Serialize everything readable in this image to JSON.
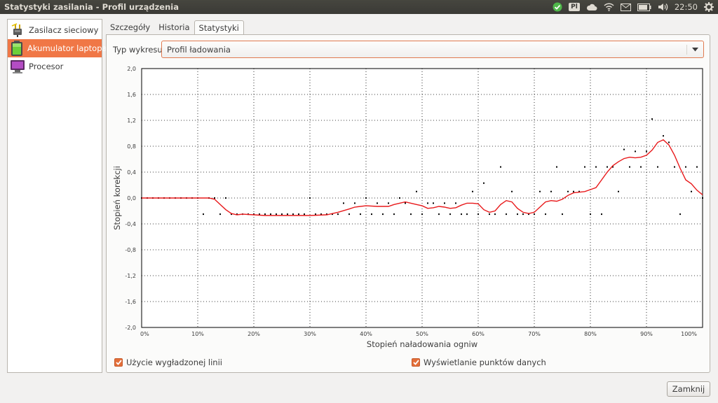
{
  "window": {
    "title": "Statystyki zasilania - Profil urządzenia"
  },
  "tray": {
    "keyboard": "Pl",
    "clock": "22:50",
    "icons": [
      "update-check-icon",
      "keyboard-layout-icon",
      "cloud-icon",
      "wifi-icon",
      "mail-icon",
      "battery-icon",
      "volume-icon",
      "clock",
      "power-gear-icon"
    ]
  },
  "sidebar": {
    "items": [
      {
        "label": "Zasilacz sieciowy",
        "icon": "ac-adapter-icon",
        "selected": false
      },
      {
        "label": "Akumulator laptopa",
        "icon": "battery-icon",
        "selected": true
      },
      {
        "label": "Procesor",
        "icon": "monitor-icon",
        "selected": false
      }
    ]
  },
  "tabs": [
    {
      "label": "Szczegóły",
      "active": false
    },
    {
      "label": "Historia",
      "active": false
    },
    {
      "label": "Statystyki",
      "active": true
    }
  ],
  "graph_type": {
    "label": "Typ wykresu:",
    "value": "Profil ładowania"
  },
  "checkboxes": {
    "smoothed": {
      "label": "Użycie wygładzonej linii",
      "checked": true
    },
    "points": {
      "label": "Wyświetlanie punktów danych",
      "checked": true
    }
  },
  "buttons": {
    "close": "Zamknij"
  },
  "colors": {
    "accent": "#f07746",
    "line": "#e8181a",
    "panel": "#fbfbfa"
  },
  "chart_data": {
    "type": "scatter",
    "xlabel": "Stopień naładowania ogniw",
    "ylabel": "Stopień korekcji",
    "xlim": [
      0,
      100
    ],
    "ylim": [
      -2.0,
      2.0
    ],
    "grid": true,
    "x_ticks": [
      "0%",
      "10%",
      "20%",
      "30%",
      "40%",
      "50%",
      "60%",
      "70%",
      "80%",
      "90%",
      "100%"
    ],
    "y_ticks": [
      "2,0",
      "1,6",
      "1,2",
      "0,8",
      "0,4",
      "0,0",
      "-0,4",
      "-0,8",
      "-1,2",
      "-1,6",
      "-2,0"
    ],
    "series": [
      {
        "type": "points",
        "x": [
          0,
          1,
          2,
          3,
          4,
          5,
          6,
          7,
          8,
          9,
          10,
          11,
          12,
          13,
          14,
          15,
          16,
          17,
          18,
          19,
          20,
          21,
          22,
          23,
          24,
          25,
          26,
          27,
          28,
          29,
          30,
          31,
          32,
          33,
          34,
          35,
          36,
          37,
          38,
          39,
          40,
          41,
          42,
          43,
          44,
          45,
          46,
          47,
          48,
          49,
          50,
          51,
          52,
          53,
          54,
          55,
          56,
          57,
          58,
          59,
          60,
          61,
          62,
          63,
          64,
          65,
          66,
          67,
          68,
          69,
          70,
          71,
          72,
          73,
          74,
          75,
          76,
          77,
          78,
          79,
          80,
          81,
          82,
          83,
          84,
          85,
          86,
          87,
          88,
          89,
          90,
          91,
          92,
          93,
          94,
          95,
          96,
          97,
          98,
          99,
          100
        ],
        "y": [
          0,
          0,
          0,
          0,
          0,
          0,
          0,
          0,
          0,
          0,
          0,
          -0.25,
          0,
          0,
          -0.25,
          0,
          -0.25,
          -0.25,
          -0.25,
          -0.25,
          -0.25,
          -0.25,
          -0.25,
          -0.25,
          -0.25,
          -0.25,
          -0.25,
          -0.25,
          -0.25,
          -0.25,
          0,
          -0.25,
          -0.25,
          -0.25,
          -0.25,
          -0.25,
          -0.08,
          -0.25,
          -0.08,
          -0.25,
          0,
          -0.25,
          -0.08,
          -0.25,
          -0.08,
          -0.25,
          0,
          -0.08,
          -0.25,
          0.1,
          -0.25,
          -0.08,
          -0.08,
          -0.25,
          -0.08,
          -0.25,
          -0.08,
          -0.25,
          -0.25,
          0.1,
          -0.25,
          0.23,
          -0.25,
          -0.25,
          0.48,
          -0.25,
          0.1,
          -0.25,
          -0.25,
          -0.25,
          -0.25,
          0.1,
          -0.25,
          0.1,
          0.48,
          -0.25,
          0.1,
          0.1,
          0.1,
          0.48,
          -0.25,
          0.48,
          -0.25,
          0.48,
          0.48,
          0.1,
          0.75,
          0.48,
          0.72,
          0.48,
          0.72,
          1.22,
          0.48,
          0.96,
          0.86,
          0.48,
          -0.25,
          0.48,
          0.1,
          0.48,
          0
        ]
      },
      {
        "type": "smoothed",
        "x": [
          0,
          5,
          10,
          12,
          13,
          14,
          15,
          16,
          17,
          18,
          20,
          22,
          25,
          30,
          33,
          35,
          37,
          38,
          40,
          42,
          44,
          45,
          46,
          47,
          48,
          49,
          50,
          51,
          52,
          53,
          54,
          55,
          56,
          57,
          58,
          59,
          60,
          61,
          62,
          63,
          64,
          65,
          66,
          67,
          68,
          69,
          70,
          71,
          72,
          73,
          74,
          75,
          76,
          77,
          78,
          79,
          80,
          81,
          82,
          83,
          84,
          85,
          86,
          87,
          88,
          89,
          90,
          91,
          92,
          93,
          94,
          95,
          96,
          97,
          98,
          99,
          100
        ],
        "y": [
          0,
          0,
          0,
          0,
          -0.02,
          -0.1,
          -0.18,
          -0.24,
          -0.26,
          -0.25,
          -0.26,
          -0.27,
          -0.27,
          -0.27,
          -0.26,
          -0.22,
          -0.17,
          -0.14,
          -0.12,
          -0.13,
          -0.13,
          -0.1,
          -0.08,
          -0.06,
          -0.08,
          -0.1,
          -0.12,
          -0.16,
          -0.15,
          -0.13,
          -0.14,
          -0.16,
          -0.15,
          -0.11,
          -0.08,
          -0.08,
          -0.09,
          -0.18,
          -0.22,
          -0.2,
          -0.1,
          -0.04,
          -0.06,
          -0.16,
          -0.22,
          -0.24,
          -0.22,
          -0.14,
          -0.06,
          -0.04,
          -0.05,
          -0.02,
          0.04,
          0.08,
          0.09,
          0.1,
          0.13,
          0.16,
          0.28,
          0.4,
          0.5,
          0.56,
          0.61,
          0.63,
          0.62,
          0.63,
          0.66,
          0.74,
          0.86,
          0.9,
          0.82,
          0.66,
          0.46,
          0.28,
          0.22,
          0.12,
          0.05
        ]
      }
    ]
  }
}
